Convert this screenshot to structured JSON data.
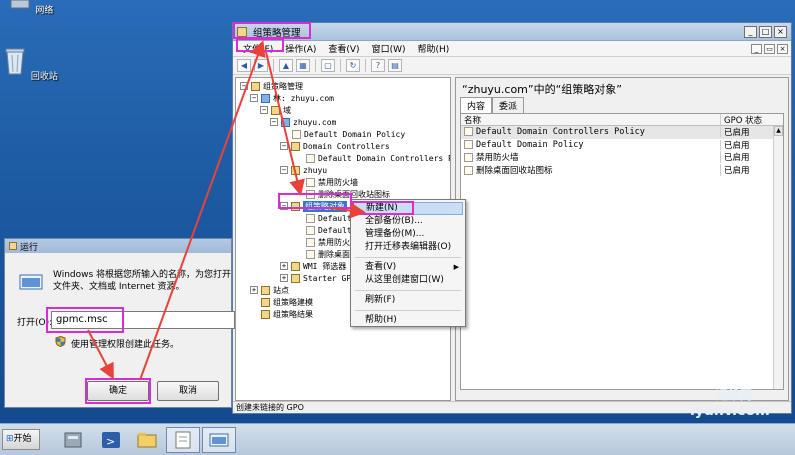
{
  "desktop": {
    "icons": [
      {
        "label": "网络",
        "icon": "network-icon"
      },
      {
        "label": "回收站",
        "icon": "recycle-bin-icon"
      }
    ]
  },
  "gpmc": {
    "title": "组策略管理",
    "menu": [
      "文件(F)",
      "操作(A)",
      "查看(V)",
      "窗口(W)",
      "帮助(H)"
    ],
    "tree": {
      "root": "组策略管理",
      "forest": "林: zhuyu.com",
      "domains": "域",
      "domain": "zhuyu.com",
      "default_domain_policy": "Default Domain Policy",
      "domain_controllers": "Domain Controllers",
      "default_dc_policy": "Default Domain Controllers Po",
      "ou": "zhuyu",
      "ou_gpo_1": "禁用防火墙",
      "ou_gpo_2": "删除桌面回收站图标",
      "gpo_container": "组策略对象",
      "gpo_children": [
        "Default",
        "Default",
        "禁用防火",
        "删除桌面"
      ],
      "wmi_filters": "WMI 筛选器",
      "starter_gpos": "Starter GP",
      "sites": "站点",
      "modeling": "组策略建模",
      "results": "组策略结果"
    },
    "right": {
      "heading": "“zhuyu.com”中的“组策略对象”",
      "tabs": [
        "内容",
        "委派"
      ],
      "columns": [
        "名称",
        "GPO 状态"
      ],
      "rows": [
        {
          "name": "Default Domain Controllers Policy",
          "status": "已启用"
        },
        {
          "name": "Default Domain Policy",
          "status": "已启用"
        },
        {
          "name": "禁用防火墙",
          "status": "已启用"
        },
        {
          "name": "删除桌面回收站图标",
          "status": "已启用"
        }
      ]
    },
    "status_text": "创建未链接的 GPO",
    "context_menu": {
      "items": [
        "新建(N)",
        "全部备份(B)...",
        "管理备份(M)...",
        "打开迁移表编辑器(O)",
        "查看(V)",
        "从这里创建窗口(W)",
        "刷新(F)",
        "帮助(H)"
      ]
    }
  },
  "run_dialog": {
    "title": "运行",
    "description": "Windows 将根据您所输入的名称，为您打开",
    "description_line2": "文件夹、文档或 Internet 资源。",
    "open_label": "打开(O):",
    "input_value": "gpmc.msc",
    "admin_note": "使用管理权限创建此任务。",
    "ok_label": "确定",
    "cancel_label": "取消"
  },
  "taskbar": {
    "start_label": "开始"
  },
  "watermark": {
    "line1": "运维网",
    "line2": "iyunv.com"
  },
  "colors": {
    "highlight": "#d62ed2",
    "arrow": "#e8423a",
    "selection": "#3a77c8"
  }
}
